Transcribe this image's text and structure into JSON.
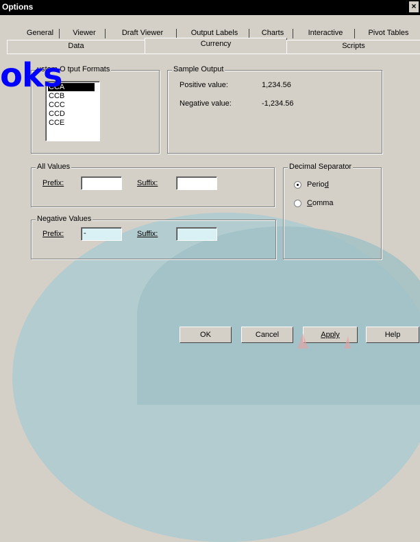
{
  "window": {
    "title": "Options",
    "close_glyph": "×"
  },
  "tabs_row1": [
    "General",
    "Viewer",
    "Draft Viewer",
    "Output Labels",
    "Charts",
    "Interactive",
    "Pivot Tables"
  ],
  "tabs_row2": [
    "Data",
    "Currency",
    "Scripts"
  ],
  "brand_text": "oks",
  "custom_formats": {
    "label": "Custom Output Formats",
    "label_visible": "ustom O  tput Formats",
    "items": [
      "CCA",
      "CCB",
      "CCC",
      "CCD",
      "CCE"
    ],
    "selected": "CCA"
  },
  "sample_output": {
    "label": "Sample Output",
    "positive_label": "Positive value:",
    "positive_value": "1,234.56",
    "negative_label": "Negative value:",
    "negative_value": "-1,234.56"
  },
  "all_values": {
    "label": "All Values",
    "prefix_label": "Prefix:",
    "prefix_value": "",
    "suffix_label": "Suffix:",
    "suffix_value": ""
  },
  "negative_values": {
    "label": "Negative Values",
    "prefix_label": "Prefix:",
    "prefix_value": "-",
    "suffix_label": "Suffix:",
    "suffix_value": ""
  },
  "decimal_separator": {
    "label": "Decimal Separator",
    "options": [
      "Period",
      "Comma"
    ],
    "selected": "Period"
  },
  "buttons": {
    "ok": "OK",
    "cancel": "Cancel",
    "apply": "Apply",
    "help": "Help"
  },
  "colors": {
    "titlebar": "#000000",
    "dialog": "#d4d0c8",
    "disabled_field": "#d9f1f4",
    "brand": "#0000ff",
    "backdrop_arc": "#afcbcf"
  }
}
